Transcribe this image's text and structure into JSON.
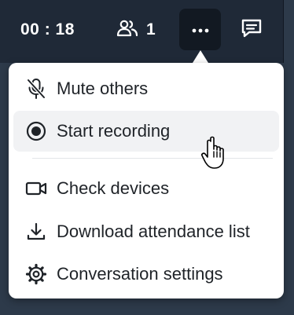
{
  "topbar": {
    "timer": "00 : 18",
    "participants_count": "1",
    "participants_icon": "people-icon",
    "more_icon": "more-horizontal-icon",
    "chat_icon": "chat-icon"
  },
  "menu": {
    "items": [
      {
        "label": "Mute others",
        "icon": "mic-off-icon"
      },
      {
        "label": "Start recording",
        "icon": "record-icon",
        "hovered": true
      },
      {
        "label": "Check devices",
        "icon": "video-camera-icon"
      },
      {
        "label": "Download attendance list",
        "icon": "download-icon"
      },
      {
        "label": "Conversation settings",
        "icon": "gear-icon"
      }
    ]
  },
  "colors": {
    "topbar_bg": "#1f2937",
    "active_button_bg": "#121922",
    "menu_bg": "#ffffff",
    "hover_bg": "#f1f2f4",
    "text": "#1f2328"
  }
}
